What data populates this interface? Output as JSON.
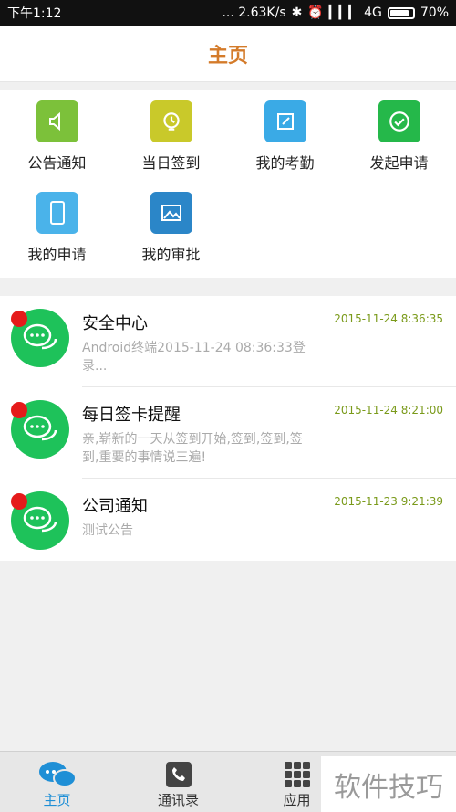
{
  "status_bar": {
    "time": "下午1:12",
    "speed": "... 2.63K/s",
    "network": "4G",
    "battery": "70%"
  },
  "header": {
    "title": "主页"
  },
  "grid": [
    {
      "label": "公告通知",
      "icon": "announcement-icon",
      "color": "#7cc13a"
    },
    {
      "label": "当日签到",
      "icon": "checkin-icon",
      "color": "#c9c92a"
    },
    {
      "label": "我的考勤",
      "icon": "attendance-icon",
      "color": "#3aaae6"
    },
    {
      "label": "发起申请",
      "icon": "check-circle-icon",
      "color": "#25b84a"
    },
    {
      "label": "我的申请",
      "icon": "phone-icon",
      "color": "#4ab3ea"
    },
    {
      "label": "我的审批",
      "icon": "picture-icon",
      "color": "#2b86c8"
    }
  ],
  "messages": [
    {
      "name": "安全中心",
      "time": "2015-11-24 8:36:35",
      "preview": "Android终端2015-11-24 08:36:33登录..."
    },
    {
      "name": "每日签卡提醒",
      "time": "2015-11-24 8:21:00",
      "preview": "亲,崭新的一天从签到开始,签到,签到,签到,重要的事情说三遍!"
    },
    {
      "name": "公司通知",
      "time": "2015-11-23 9:21:39",
      "preview": "测试公告"
    }
  ],
  "tabs": [
    {
      "label": "主页",
      "active": true
    },
    {
      "label": "通讯录",
      "active": false
    },
    {
      "label": "应用",
      "active": false
    }
  ],
  "watermark": "软件技巧",
  "colors": {
    "accent": "#d47b2a",
    "active_tab": "#1f8fd6",
    "avatar": "#1ec25a",
    "badge": "#e51b1b"
  }
}
